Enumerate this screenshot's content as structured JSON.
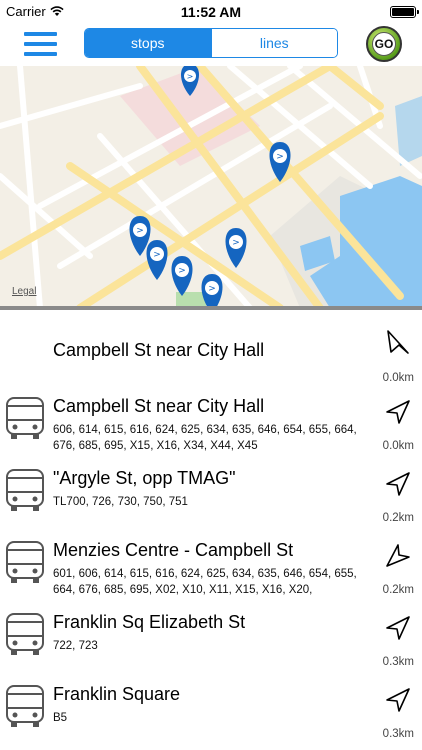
{
  "status_bar": {
    "carrier": "Carrier",
    "time": "11:52 AM"
  },
  "header": {
    "tabs": [
      {
        "label": "stops",
        "active": true
      },
      {
        "label": "lines",
        "active": false
      }
    ],
    "go_label": "GO",
    "accent_color": "#1e88e5"
  },
  "map": {
    "legal_label": "Legal",
    "marker_icon": "bus-stop-pin-icon",
    "marker_count": 7
  },
  "stops": [
    {
      "name": "Campbell St near City Hall",
      "routes": "",
      "distance": "0.0km",
      "icon": "location-arrow-icon",
      "has_bus_icon": false
    },
    {
      "name": "Campbell St near City Hall",
      "routes": "606, 614, 615, 616, 624, 625, 634, 635, 646, 654, 655, 664, 676, 685, 695, X15, X16, X34, X44, X45",
      "distance": "0.0km",
      "icon": "location-arrow-icon",
      "has_bus_icon": true
    },
    {
      "name": "\"Argyle St, opp TMAG\"",
      "routes": "TL700, 726, 730, 750, 751",
      "distance": "0.2km",
      "icon": "location-arrow-icon",
      "has_bus_icon": true
    },
    {
      "name": "Menzies Centre - Campbell St",
      "routes": "601, 606, 614, 615, 616, 624, 625, 634, 635, 646, 654, 655, 664, 676, 685, 695, X02, X10, X11, X15, X16, X20,",
      "distance": "0.2km",
      "icon": "location-arrow-icon",
      "has_bus_icon": true
    },
    {
      "name": "Franklin Sq Elizabeth St",
      "routes": "722, 723",
      "distance": "0.3km",
      "icon": "location-arrow-icon",
      "has_bus_icon": true
    },
    {
      "name": "Franklin Square",
      "routes": "B5",
      "distance": "0.3km",
      "icon": "location-arrow-icon",
      "has_bus_icon": true
    }
  ]
}
